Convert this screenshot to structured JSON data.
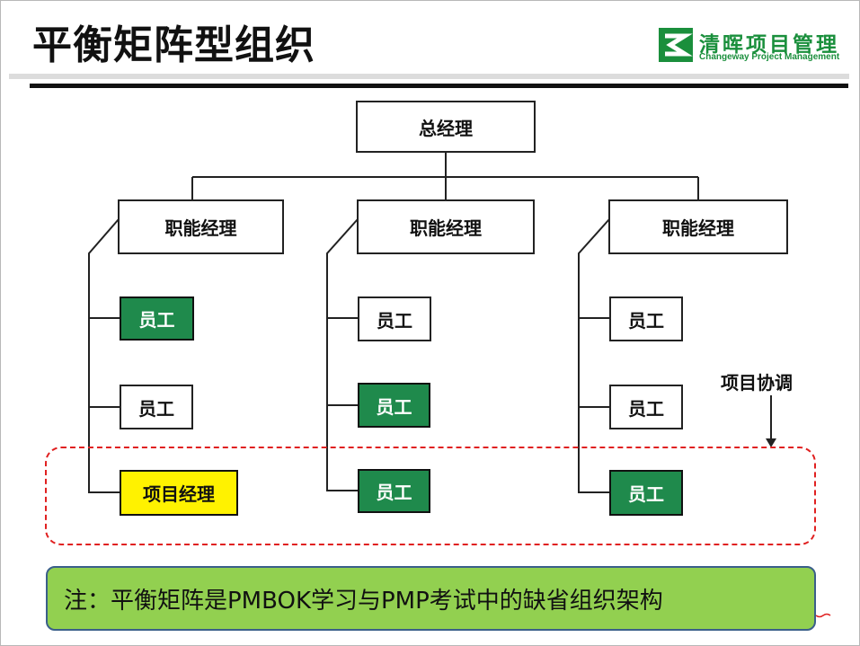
{
  "header": {
    "title": "平衡矩阵型组织",
    "brand_name": "清晖项目管理",
    "brand_sub": "Changeway Project Management",
    "brand_color": "#1a8f3c"
  },
  "org": {
    "general_manager": "总经理",
    "functional_managers": [
      "职能经理",
      "职能经理",
      "职能经理"
    ],
    "columns": [
      {
        "members": [
          {
            "label": "员工",
            "style": "green"
          },
          {
            "label": "员工",
            "style": "white"
          },
          {
            "label": "项目经理",
            "style": "yellow"
          }
        ]
      },
      {
        "members": [
          {
            "label": "员工",
            "style": "white"
          },
          {
            "label": "员工",
            "style": "green"
          },
          {
            "label": "员工",
            "style": "green"
          }
        ]
      },
      {
        "members": [
          {
            "label": "员工",
            "style": "white"
          },
          {
            "label": "员工",
            "style": "white"
          },
          {
            "label": "员工",
            "style": "green"
          }
        ]
      }
    ],
    "project_coordination": "项目协调"
  },
  "colors": {
    "green": "#1f8a4c",
    "yellow": "#fff200",
    "dashed_border": "#e02020",
    "note_background": "#92d050"
  },
  "note": "注：平衡矩阵是PMBOK学习与PMP考试中的缺省组织架构"
}
